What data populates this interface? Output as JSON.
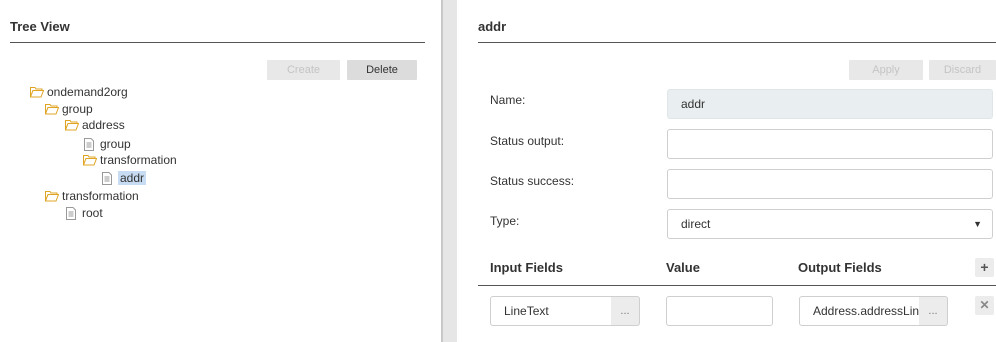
{
  "left": {
    "title": "Tree View",
    "create_label": "Create",
    "delete_label": "Delete",
    "tree": [
      {
        "label": "ondemand2org",
        "type": "folder"
      },
      {
        "label": "group",
        "type": "folder"
      },
      {
        "label": "address",
        "type": "folder"
      },
      {
        "label": "group",
        "type": "file"
      },
      {
        "label": "transformation",
        "type": "folder"
      },
      {
        "label": "addr",
        "type": "file",
        "selected": true
      },
      {
        "label": "transformation",
        "type": "folder"
      },
      {
        "label": "root",
        "type": "file"
      }
    ]
  },
  "right": {
    "title": "addr",
    "apply_label": "Apply",
    "discard_label": "Discard",
    "name_label": "Name:",
    "name_value": "addr",
    "status_output_label": "Status output:",
    "status_output_value": "",
    "status_success_label": "Status success:",
    "status_success_value": "",
    "type_label": "Type:",
    "type_value": "direct",
    "columns": {
      "input": "Input Fields",
      "value": "Value",
      "output": "Output Fields"
    },
    "row": {
      "input": "LineText",
      "input_btn": "...",
      "value": "",
      "output": "Address.addressLin",
      "output_btn": "..."
    }
  },
  "colors": {
    "accent_selected": "#c7dcf2",
    "folder": "#e0a424"
  }
}
